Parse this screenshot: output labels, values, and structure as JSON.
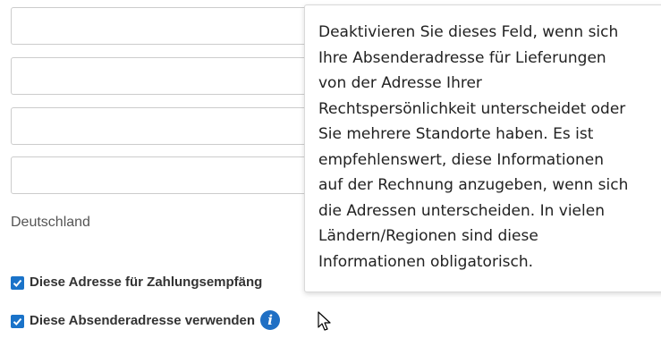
{
  "form": {
    "fields": [
      {
        "value": ""
      },
      {
        "value": ""
      },
      {
        "value": ""
      },
      {
        "value": ""
      }
    ],
    "country": "Deutschland",
    "checkbox_payee_label": "Diese Adresse für Zahlungsempfäng",
    "checkbox_payee_checked": true,
    "checkbox_sender_label": "Diese Absenderadresse verwenden",
    "checkbox_sender_checked": true,
    "info_icon_glyph": "i"
  },
  "tooltip": {
    "lines": [
      "Deaktivieren Sie dieses Feld, wenn sich",
      "Ihre Absenderadresse für Lieferungen",
      "von der Adresse Ihrer",
      "Rechtspersönlichkeit unterscheidet oder",
      "Sie mehrere Standorte haben. Es ist",
      "empfehlenswert, diese Informationen",
      "auf der Rechnung anzugeben, wenn sich",
      "die Adressen unterscheiden. In vielen",
      "Ländern/Regionen sind diese",
      "Informationen obligatorisch."
    ]
  },
  "colors": {
    "checkbox": "#1a73c9",
    "info_icon": "#1f6fc4"
  }
}
